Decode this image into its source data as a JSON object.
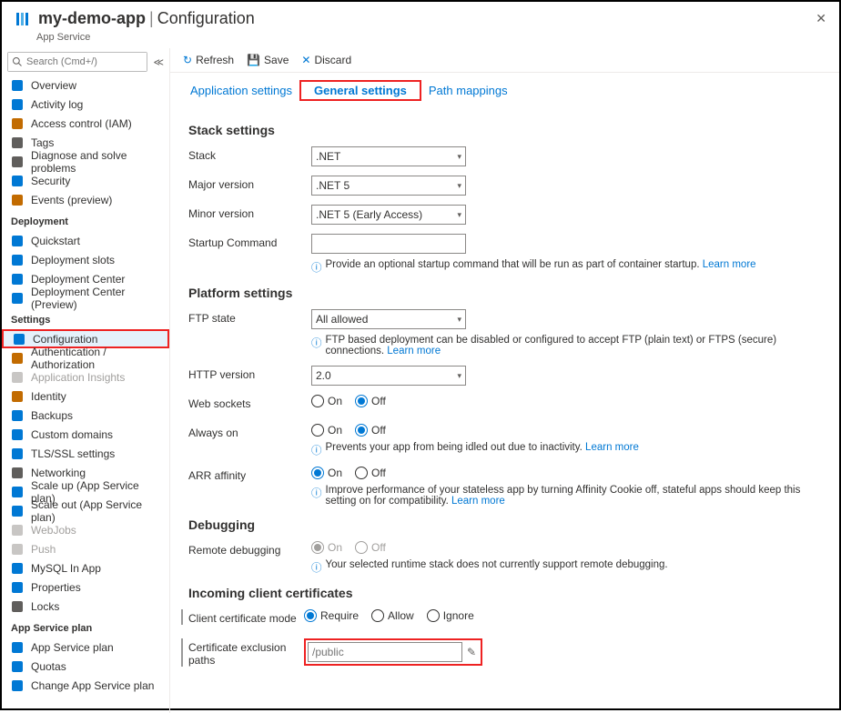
{
  "header": {
    "app_name": "my-demo-app",
    "page": "Configuration",
    "subtitle": "App Service"
  },
  "search": {
    "placeholder": "Search (Cmd+/)"
  },
  "toolbar": {
    "refresh": "Refresh",
    "save": "Save",
    "discard": "Discard"
  },
  "tabs": {
    "app": "Application settings",
    "gen": "General settings",
    "path": "Path mappings"
  },
  "nav": {
    "g_main": [
      {
        "label": "Overview",
        "c": "#0078d4"
      },
      {
        "label": "Activity log",
        "c": "#0078d4"
      },
      {
        "label": "Access control (IAM)",
        "c": "#c26b00"
      },
      {
        "label": "Tags",
        "c": "#605e5c"
      },
      {
        "label": "Diagnose and solve problems",
        "c": "#605e5c"
      },
      {
        "label": "Security",
        "c": "#0078d4"
      },
      {
        "label": "Events (preview)",
        "c": "#c26b00"
      }
    ],
    "g_deploy_h": "Deployment",
    "g_deploy": [
      {
        "label": "Quickstart",
        "c": "#0078d4"
      },
      {
        "label": "Deployment slots",
        "c": "#0078d4"
      },
      {
        "label": "Deployment Center",
        "c": "#0078d4"
      },
      {
        "label": "Deployment Center (Preview)",
        "c": "#0078d4"
      }
    ],
    "g_settings_h": "Settings",
    "g_settings": [
      {
        "label": "Configuration",
        "c": "#0078d4",
        "sel": true
      },
      {
        "label": "Authentication / Authorization",
        "c": "#c26b00"
      },
      {
        "label": "Application Insights",
        "c": "#a19f9d",
        "dis": true
      },
      {
        "label": "Identity",
        "c": "#c26b00"
      },
      {
        "label": "Backups",
        "c": "#0078d4"
      },
      {
        "label": "Custom domains",
        "c": "#0078d4"
      },
      {
        "label": "TLS/SSL settings",
        "c": "#0078d4"
      },
      {
        "label": "Networking",
        "c": "#605e5c"
      },
      {
        "label": "Scale up (App Service plan)",
        "c": "#0078d4"
      },
      {
        "label": "Scale out (App Service plan)",
        "c": "#0078d4"
      },
      {
        "label": "WebJobs",
        "c": "#a19f9d",
        "dis": true
      },
      {
        "label": "Push",
        "c": "#a19f9d",
        "dis": true
      },
      {
        "label": "MySQL In App",
        "c": "#0078d4"
      },
      {
        "label": "Properties",
        "c": "#0078d4"
      },
      {
        "label": "Locks",
        "c": "#605e5c"
      }
    ],
    "g_plan_h": "App Service plan",
    "g_plan": [
      {
        "label": "App Service plan",
        "c": "#0078d4"
      },
      {
        "label": "Quotas",
        "c": "#0078d4"
      },
      {
        "label": "Change App Service plan",
        "c": "#0078d4"
      }
    ]
  },
  "stack": {
    "h": "Stack settings",
    "stack_l": "Stack",
    "stack_v": ".NET",
    "major_l": "Major version",
    "major_v": ".NET 5",
    "minor_l": "Minor version",
    "minor_v": ".NET 5 (Early Access)",
    "startup_l": "Startup Command",
    "startup_help": "Provide an optional startup command that will be run as part of container startup.",
    "learn": "Learn more"
  },
  "platform": {
    "h": "Platform settings",
    "ftp_l": "FTP state",
    "ftp_v": "All allowed",
    "ftp_help": "FTP based deployment can be disabled or configured to accept FTP (plain text) or FTPS (secure) connections.",
    "http_l": "HTTP version",
    "http_v": "2.0",
    "ws_l": "Web sockets",
    "always_l": "Always on",
    "always_help": "Prevents your app from being idled out due to inactivity.",
    "arr_l": "ARR affinity",
    "arr_help": "Improve performance of your stateless app by turning Affinity Cookie off, stateful apps should keep this setting on for compatibility.",
    "on": "On",
    "off": "Off",
    "learn": "Learn more"
  },
  "debug": {
    "h": "Debugging",
    "rd_l": "Remote debugging",
    "rd_help": "Your selected runtime stack does not currently support remote debugging.",
    "on": "On",
    "off": "Off"
  },
  "cert": {
    "h": "Incoming client certificates",
    "mode_l": "Client certificate mode",
    "require": "Require",
    "allow": "Allow",
    "ignore": "Ignore",
    "excl_l": "Certificate exclusion paths",
    "excl_ph": "/public"
  }
}
